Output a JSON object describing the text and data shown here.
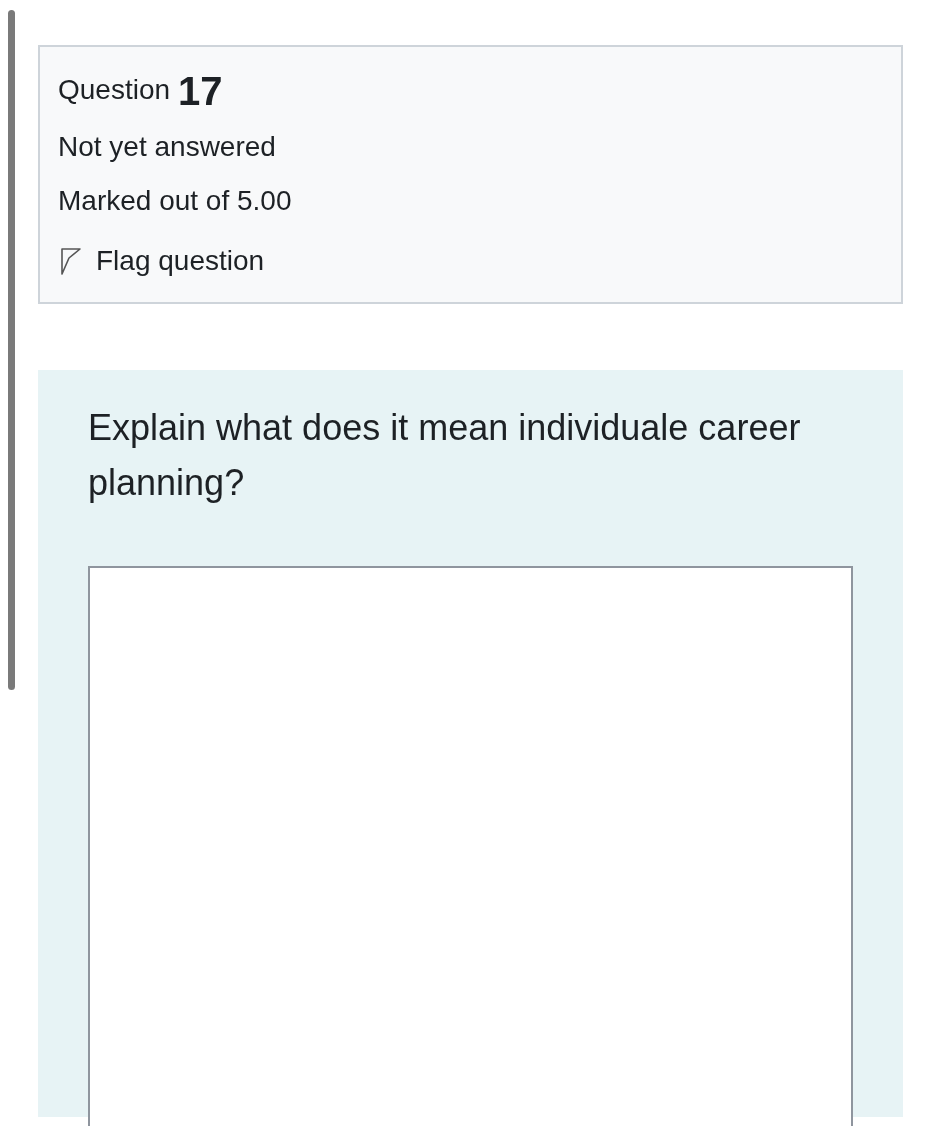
{
  "info": {
    "label": "Question",
    "number": "17",
    "status": "Not yet answered",
    "marks": "Marked out of 5.00",
    "flag": {
      "label": "Flag question",
      "flagged": false
    }
  },
  "question": {
    "text": "Explain what does it mean individuale career planning?"
  }
}
